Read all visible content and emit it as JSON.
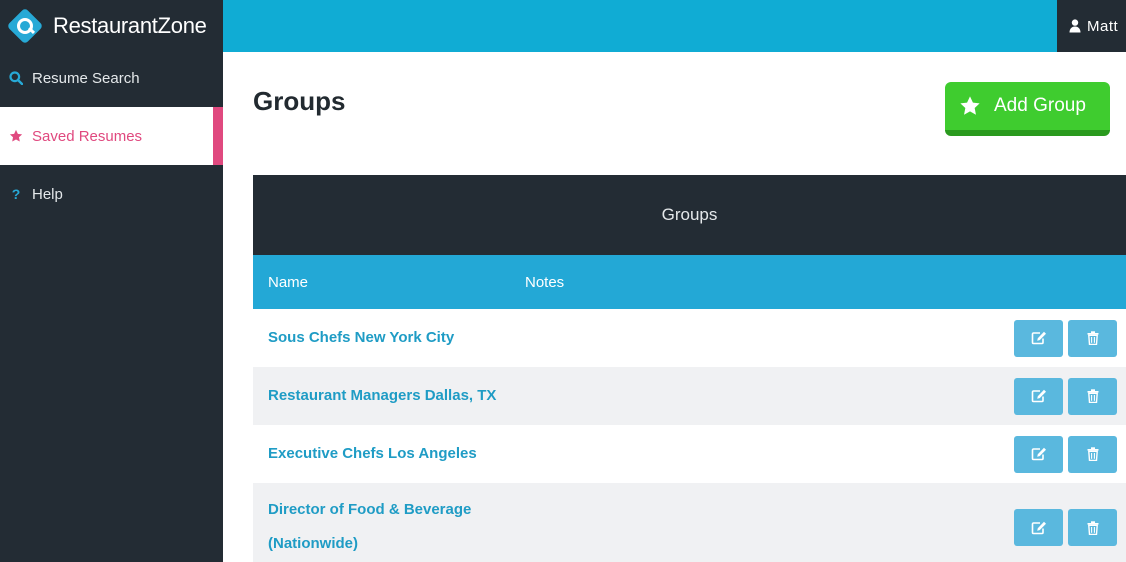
{
  "brand": {
    "name": "RestaurantZone",
    "logo_icon": "restaurantzone-logo-icon"
  },
  "sidebar": {
    "items": [
      {
        "label": "Resume Search",
        "icon": "search-icon"
      },
      {
        "label": "Saved Resumes",
        "icon": "star-icon",
        "active": true
      },
      {
        "label": "Help",
        "icon": "question-icon"
      }
    ]
  },
  "topbar": {
    "user_name": "Matt",
    "user_icon": "user-icon"
  },
  "page": {
    "title": "Groups",
    "add_button_label": "Add Group"
  },
  "table": {
    "caption": "Groups",
    "columns": [
      "Name",
      "Notes"
    ],
    "rows": [
      {
        "name": "Sous Chefs New York City",
        "notes": ""
      },
      {
        "name": "Restaurant Managers Dallas, TX",
        "notes": ""
      },
      {
        "name": "Executive Chefs Los Angeles",
        "notes": ""
      },
      {
        "name": "Director of Food & Beverage (Nationwide)",
        "notes": ""
      }
    ],
    "row_actions": [
      "edit-icon",
      "trash-icon"
    ]
  },
  "colors": {
    "sidebar_bg": "#232c34",
    "topbar_bg": "#10acd4",
    "accent_pink": "#e0497f",
    "add_button_green": "#3fcc2f",
    "table_header_blue": "#23a8d6",
    "link_blue": "#1f9cc5",
    "action_button_blue": "#5ab8de"
  }
}
